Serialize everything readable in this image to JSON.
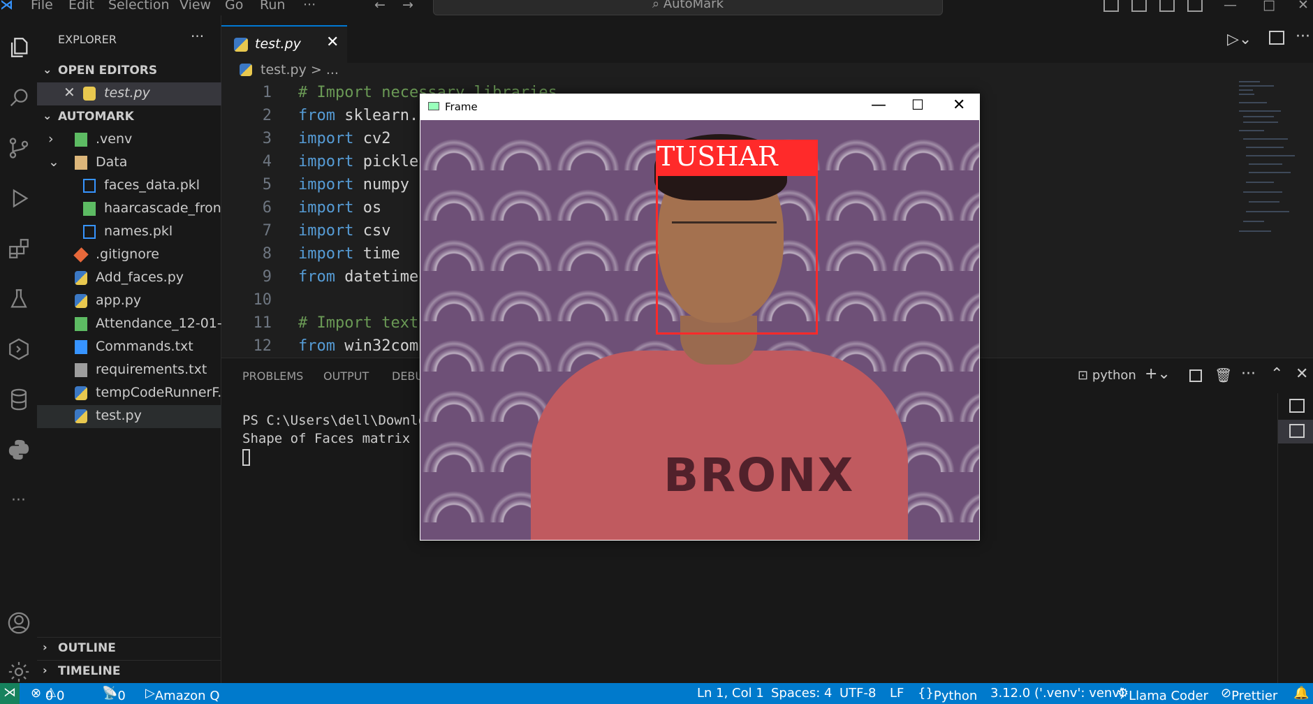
{
  "titlebar": {
    "menus": [
      "File",
      "Edit",
      "Selection",
      "View",
      "Go",
      "Run",
      "···"
    ],
    "search": "AutoMark"
  },
  "sidebar": {
    "header": "EXPLORER",
    "more": "···",
    "open_editors_label": "OPEN EDITORS",
    "open_editor_file": "test.py",
    "project_label": "AUTOMARK",
    "files": [
      {
        "name": ".venv",
        "icon": "folder-env-icon",
        "color": "#5dbb63"
      },
      {
        "name": "Data",
        "icon": "folder-open-icon",
        "color": "#dcb67a"
      },
      {
        "name": "faces_data.pkl",
        "icon": "file-icon",
        "color": "#3794ff"
      },
      {
        "name": "haarcascade_fron...",
        "icon": "xml-file-icon",
        "color": "#5dbb63"
      },
      {
        "name": "names.pkl",
        "icon": "file-icon",
        "color": "#3794ff"
      },
      {
        "name": ".gitignore",
        "icon": "git-icon",
        "color": "#e8683a"
      },
      {
        "name": "Add_faces.py",
        "icon": "python-icon",
        "color": "#e8c84f"
      },
      {
        "name": "app.py",
        "icon": "python-icon",
        "color": "#e8c84f"
      },
      {
        "name": "Attendance_12-01-...",
        "icon": "csv-icon",
        "color": "#5dbb63"
      },
      {
        "name": "Commands.txt",
        "icon": "text-file-icon",
        "color": "#3794ff"
      },
      {
        "name": "requirements.txt",
        "icon": "requirements-icon",
        "color": "#9d9d9d"
      },
      {
        "name": "tempCodeRunnerF...",
        "icon": "python-icon",
        "color": "#e8c84f"
      },
      {
        "name": "test.py",
        "icon": "python-icon",
        "color": "#e8c84f"
      }
    ],
    "outline_label": "OUTLINE",
    "timeline_label": "TIMELINE"
  },
  "editor": {
    "tab": "test.py",
    "breadcrumb": "test.py > ...",
    "lines": [
      {
        "n": "1",
        "kw": "",
        "rest": "",
        "comment": "# Import necessary libraries"
      },
      {
        "n": "2",
        "kw": "from",
        "rest": " sklearn.",
        "comment": ""
      },
      {
        "n": "3",
        "kw": "import",
        "rest": " cv2",
        "comment": ""
      },
      {
        "n": "4",
        "kw": "import",
        "rest": " pickle",
        "comment": ""
      },
      {
        "n": "5",
        "kw": "import",
        "rest": " numpy",
        "comment": ""
      },
      {
        "n": "6",
        "kw": "import",
        "rest": " os",
        "comment": ""
      },
      {
        "n": "7",
        "kw": "import",
        "rest": " csv",
        "comment": ""
      },
      {
        "n": "8",
        "kw": "import",
        "rest": " time",
        "comment": ""
      },
      {
        "n": "9",
        "kw": "from",
        "rest": " datetime",
        "comment": ""
      },
      {
        "n": "10",
        "kw": "",
        "rest": "",
        "comment": ""
      },
      {
        "n": "11",
        "kw": "",
        "rest": "",
        "comment": "# Import text"
      },
      {
        "n": "12",
        "kw": "from",
        "rest": " win32com",
        "comment": ""
      }
    ]
  },
  "panel": {
    "tabs": [
      "PROBLEMS",
      "OUTPUT",
      "DEBU"
    ],
    "terminal_name": "python",
    "terminal_lines": [
      "PS C:\\Users\\dell\\Downlo",
      "Shape of Faces matrix -"
    ]
  },
  "frame_window": {
    "title": "Frame",
    "detected_name": "TUSHAR",
    "shirt_text": "BRONX",
    "box_color": "#ff2a2a"
  },
  "status": {
    "errors": "0",
    "warnings": "0",
    "ports": "0",
    "amazon_q": "Amazon Q",
    "position": "Ln 1, Col 1",
    "spaces": "Spaces: 4",
    "encoding": "UTF-8",
    "eol": "LF",
    "language": "Python",
    "interpreter": "3.12.0 ('.venv': venv)",
    "llama": "Llama Coder",
    "prettier": "Prettier"
  }
}
